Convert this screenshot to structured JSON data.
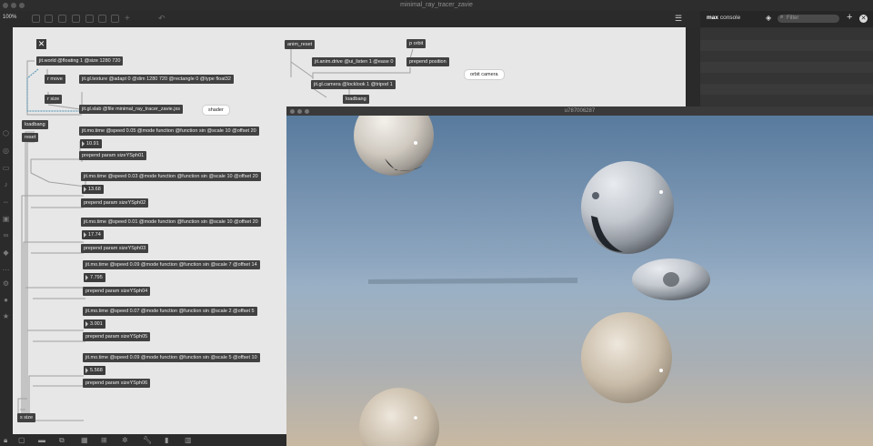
{
  "window": {
    "title": "minimal_ray_tracer_zavie",
    "viewer_title": "u787006287"
  },
  "toolbar": {
    "zoom": "100%"
  },
  "console": {
    "label_bold": "max",
    "label_rest": "console",
    "filter_placeholder": "Filter"
  },
  "patch": {
    "objects": {
      "close_x": "✕",
      "jit_world": "jit.world @floating 1 @size 1280 720",
      "r_move": "r move",
      "jit_gl_texture": "jit.gl.texture @adapt 0 @dim 1280 720 @rectangle 0 @type float32",
      "r_size": "r size",
      "jit_gl_slab": "jit.gl.slab @file minimal_ray_tracer_zavie.jxs",
      "shader_comment": "shader",
      "anim_reset": "anim_reset",
      "p_orbit": "p orbit",
      "anim_drive": "jit.anim.drive @ui_listen 1 @ease 0",
      "prepend_position": "prepend position",
      "orbit_comment": "orbit camera",
      "gl_camera": "jit.gl.camera @locklook 1 @tripod 1",
      "loadbang_top": "loadbang",
      "loadbang_left": "loadbang",
      "reset": "reset",
      "s_size": "s size"
    },
    "rows": [
      {
        "time": "jit.mo.time @speed 0.05 @mode function @function sin @scale 10 @offset 20",
        "value": "10.91",
        "prepend": "prepend param sizeYSph01"
      },
      {
        "time": "jit.mo.time @speed 0.03 @mode function @function sin @scale 10 @offset 20",
        "value": "13.68",
        "prepend": "prepend param sizeYSph02"
      },
      {
        "time": "jit.mo.time @speed 0.01 @mode function @function sin @scale 10 @offset 20",
        "value": "17.74",
        "prepend": "prepend param sizeYSph03"
      },
      {
        "time": "jit.mo.time @speed 0.09 @mode function @function sin @scale 7 @offset 14",
        "value": "7.795",
        "prepend": "prepend param sizeYSph04"
      },
      {
        "time": "jit.mo.time @speed 0.07 @mode function @function sin @scale 2 @offset 5",
        "value": "3.001",
        "prepend": "prepend param sizeYSph05"
      },
      {
        "time": "jit.mo.time @speed 0.09 @mode function @function sin @scale 5 @offset 10",
        "value": "5.568",
        "prepend": "prepend param sizeYSph06"
      }
    ]
  },
  "colors": {
    "patch_bg": "#e7e7e7",
    "object_bg": "#414141",
    "sky_top": "#5f7c9c",
    "sky_bottom": "#c7b7a1"
  }
}
